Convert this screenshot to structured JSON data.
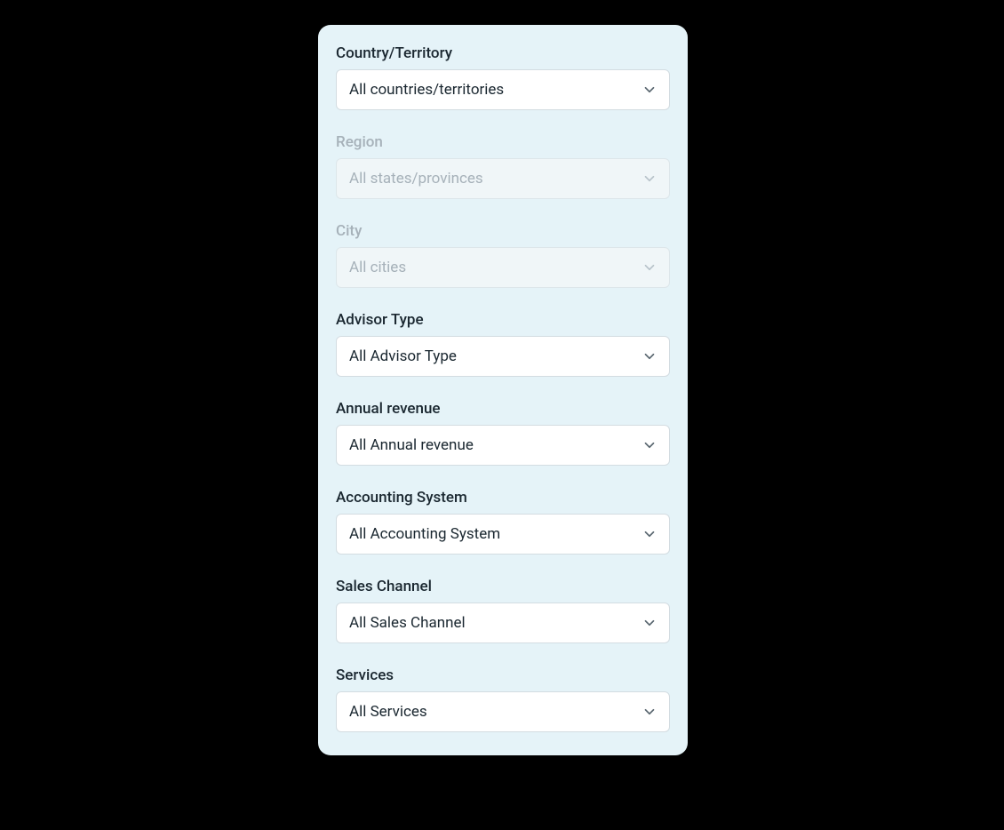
{
  "filters": {
    "country": {
      "label": "Country/Territory",
      "value": "All countries/territories",
      "disabled": false
    },
    "region": {
      "label": "Region",
      "value": "All states/provinces",
      "disabled": true
    },
    "city": {
      "label": "City",
      "value": "All cities",
      "disabled": true
    },
    "advisor_type": {
      "label": "Advisor Type",
      "value": "All Advisor Type",
      "disabled": false
    },
    "annual_revenue": {
      "label": "Annual revenue",
      "value": "All Annual revenue",
      "disabled": false
    },
    "accounting_system": {
      "label": "Accounting System",
      "value": "All Accounting System",
      "disabled": false
    },
    "sales_channel": {
      "label": "Sales Channel",
      "value": "All Sales Channel",
      "disabled": false
    },
    "services": {
      "label": "Services",
      "value": "All Services",
      "disabled": false
    }
  }
}
